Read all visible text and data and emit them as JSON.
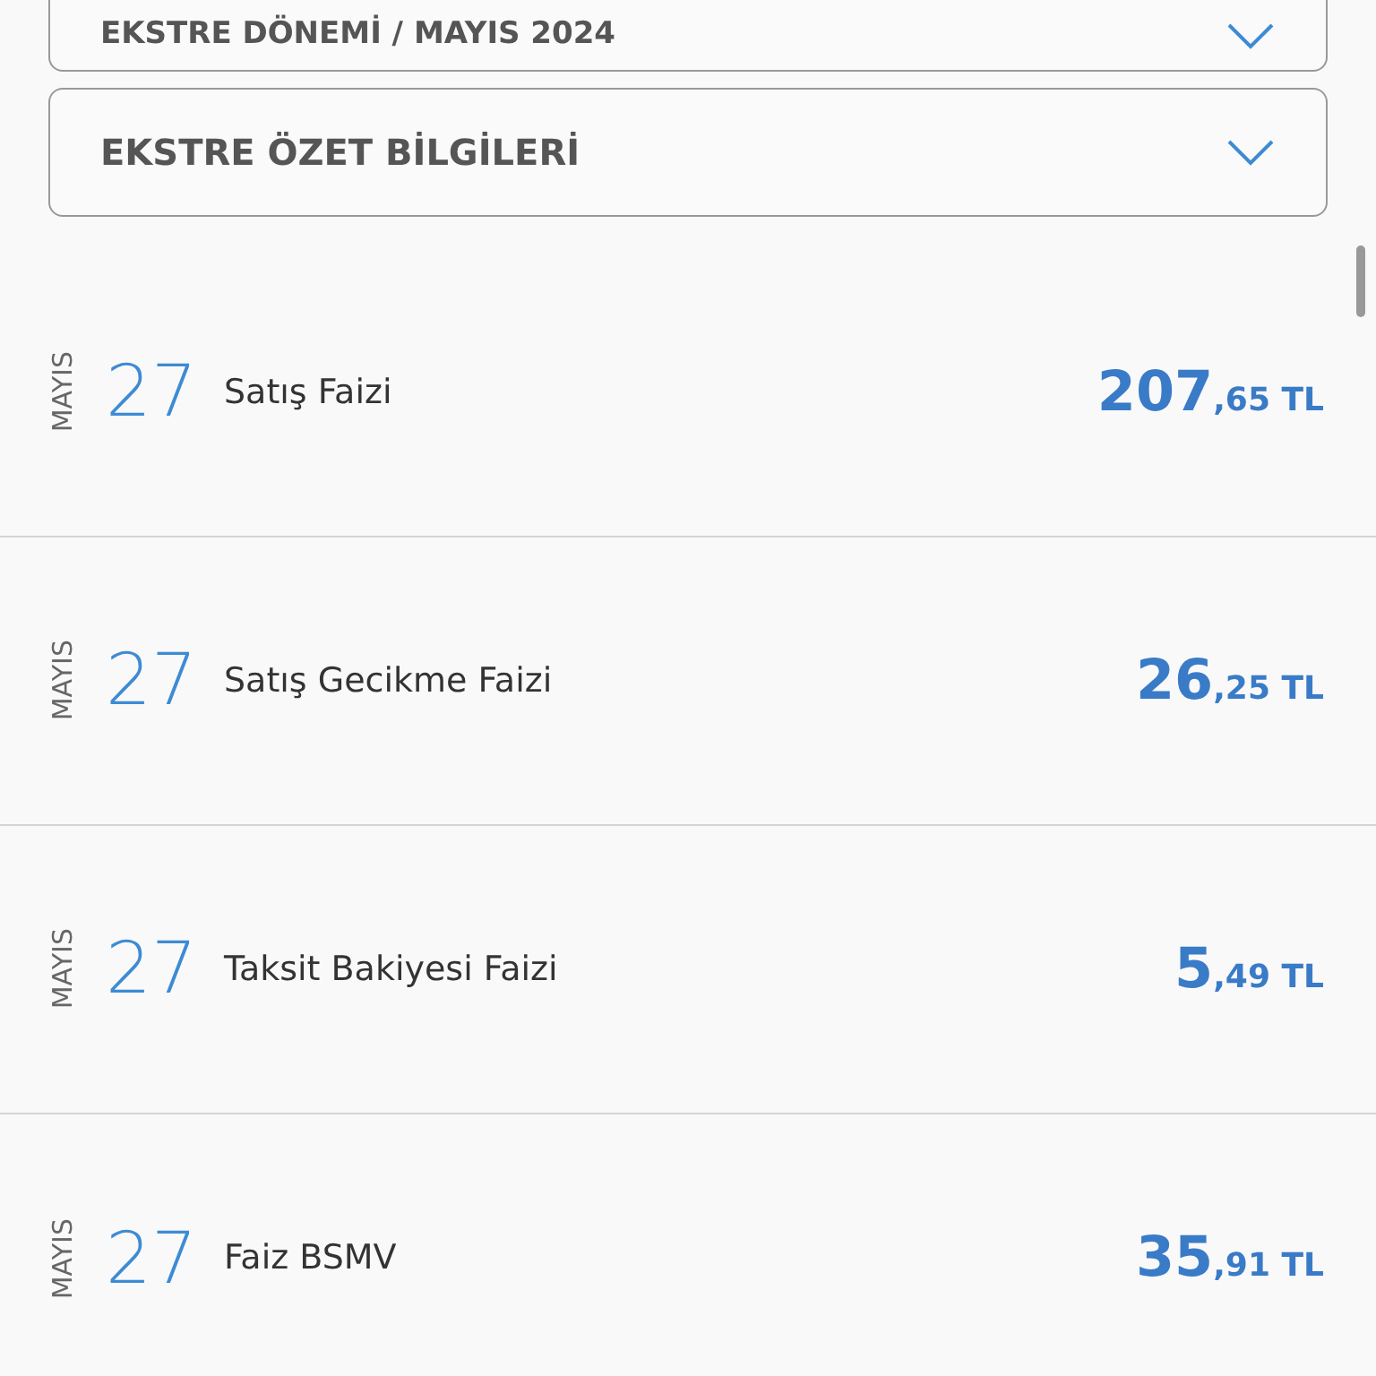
{
  "dropdowns": [
    {
      "label": "EKSTRE DÖNEMİ / MAYIS 2024",
      "expanded": false
    },
    {
      "label": "EKSTRE ÖZET BİLGİLERİ",
      "expanded": false
    }
  ],
  "transactions": [
    {
      "month": "MAYIS",
      "day": "27",
      "description": "Satış Faizi",
      "amount_whole": "207",
      "amount_fraction": ",65 TL"
    },
    {
      "month": "MAYIS",
      "day": "27",
      "description": "Satış Gecikme Faizi",
      "amount_whole": "26",
      "amount_fraction": ",25 TL"
    },
    {
      "month": "MAYIS",
      "day": "27",
      "description": "Taksit Bakiyesi Faizi",
      "amount_whole": "5",
      "amount_fraction": ",49 TL"
    },
    {
      "month": "MAYIS",
      "day": "27",
      "description": "Faiz BSMV",
      "amount_whole": "35",
      "amount_fraction": ",91 TL"
    }
  ]
}
